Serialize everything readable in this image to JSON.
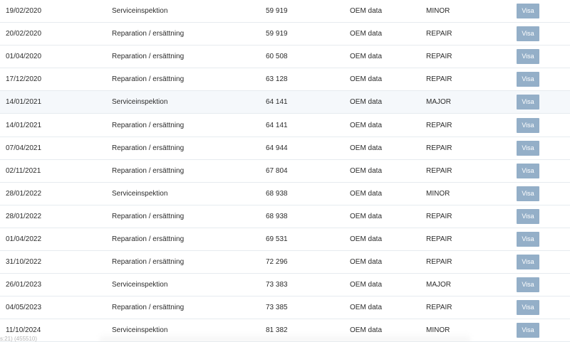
{
  "rows": [
    {
      "date": "19/02/2020",
      "type": "Serviceinspektion",
      "odometer": "59 919",
      "source": "OEM data",
      "category": "MINOR",
      "action": "Visa"
    },
    {
      "date": "20/02/2020",
      "type": "Reparation / ersättning",
      "odometer": "59 919",
      "source": "OEM data",
      "category": "REPAIR",
      "action": "Visa"
    },
    {
      "date": "01/04/2020",
      "type": "Reparation / ersättning",
      "odometer": "60 508",
      "source": "OEM data",
      "category": "REPAIR",
      "action": "Visa"
    },
    {
      "date": "17/12/2020",
      "type": "Reparation / ersättning",
      "odometer": "63 128",
      "source": "OEM data",
      "category": "REPAIR",
      "action": "Visa"
    },
    {
      "date": "14/01/2021",
      "type": "Serviceinspektion",
      "odometer": "64 141",
      "source": "OEM data",
      "category": "MAJOR",
      "action": "Visa",
      "highlighted": true
    },
    {
      "date": "14/01/2021",
      "type": "Reparation / ersättning",
      "odometer": "64 141",
      "source": "OEM data",
      "category": "REPAIR",
      "action": "Visa"
    },
    {
      "date": "07/04/2021",
      "type": "Reparation / ersättning",
      "odometer": "64 944",
      "source": "OEM data",
      "category": "REPAIR",
      "action": "Visa"
    },
    {
      "date": "02/11/2021",
      "type": "Reparation / ersättning",
      "odometer": "67 804",
      "source": "OEM data",
      "category": "REPAIR",
      "action": "Visa"
    },
    {
      "date": "28/01/2022",
      "type": "Serviceinspektion",
      "odometer": "68 938",
      "source": "OEM data",
      "category": "MINOR",
      "action": "Visa"
    },
    {
      "date": "28/01/2022",
      "type": "Reparation / ersättning",
      "odometer": "68 938",
      "source": "OEM data",
      "category": "REPAIR",
      "action": "Visa"
    },
    {
      "date": "01/04/2022",
      "type": "Reparation / ersättning",
      "odometer": "69 531",
      "source": "OEM data",
      "category": "REPAIR",
      "action": "Visa"
    },
    {
      "date": "31/10/2022",
      "type": "Reparation / ersättning",
      "odometer": "72 296",
      "source": "OEM data",
      "category": "REPAIR",
      "action": "Visa"
    },
    {
      "date": "26/01/2023",
      "type": "Serviceinspektion",
      "odometer": "73 383",
      "source": "OEM data",
      "category": "MAJOR",
      "action": "Visa"
    },
    {
      "date": "04/05/2023",
      "type": "Reparation / ersättning",
      "odometer": "73 385",
      "source": "OEM data",
      "category": "REPAIR",
      "action": "Visa"
    },
    {
      "date": "11/10/2024",
      "type": "Serviceinspektion",
      "odometer": "81 382",
      "source": "OEM data",
      "category": "MINOR",
      "action": "Visa"
    }
  ],
  "footer": {
    "note": "s:21) (455510)"
  },
  "colors": {
    "button": "#94afc8",
    "highlight_row": "#f5f8fb",
    "divider": "#e6ebef"
  }
}
